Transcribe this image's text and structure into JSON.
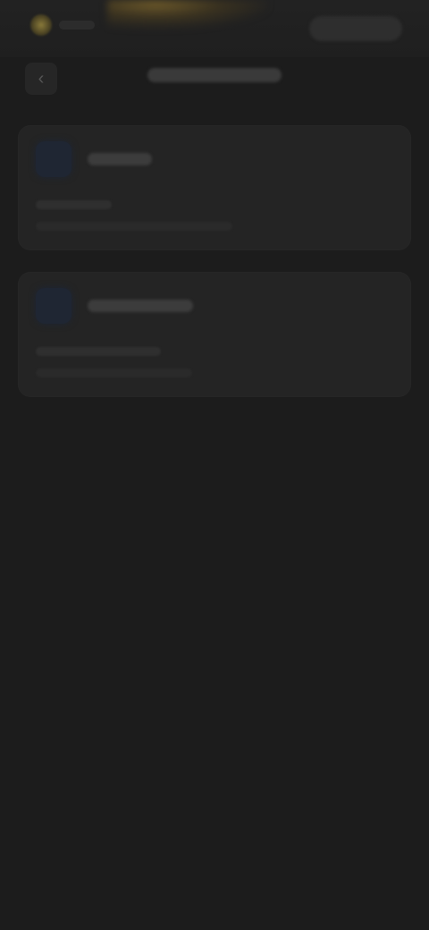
{
  "header": {
    "left_icon": "spark-icon",
    "right_control": "toolbar-pill"
  },
  "navigation": {
    "back_icon": "back-arrow-icon",
    "back_glyph": "‹"
  },
  "cards": [
    {
      "icon": "app-icon"
    },
    {
      "icon": "app-icon"
    }
  ],
  "colors": {
    "background": "#1c1c1c",
    "card": "#242424",
    "accent_glow": "#6e5a2a",
    "avatar": "#1f2633"
  }
}
